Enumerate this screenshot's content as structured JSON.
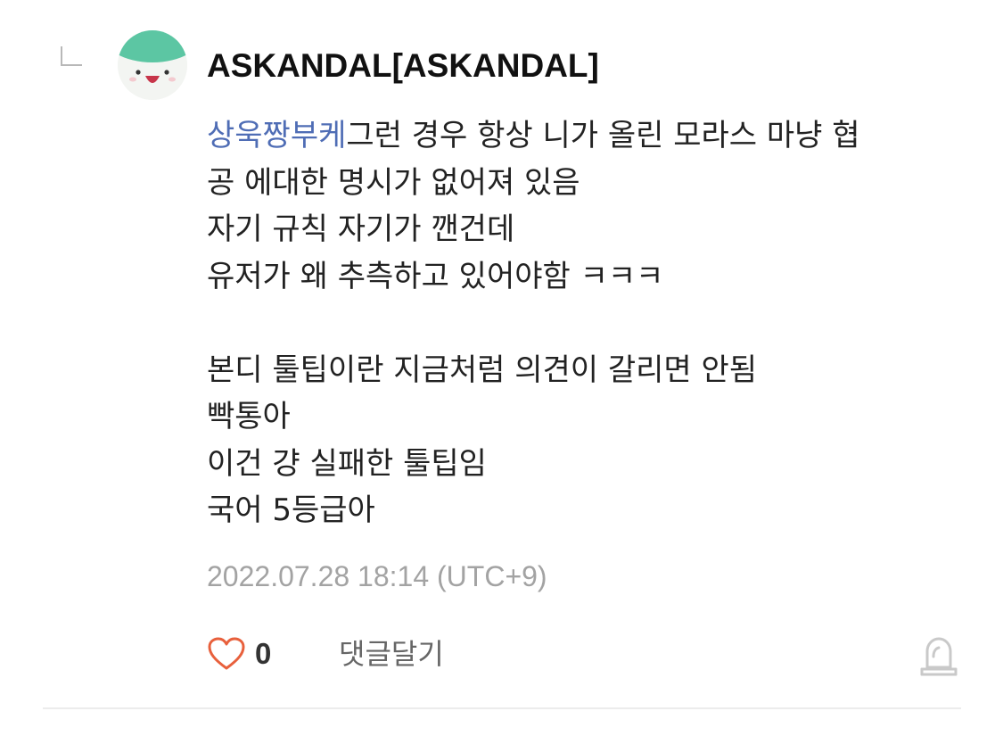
{
  "comment": {
    "author": "ASKANDAL[ASKANDAL]",
    "mention": "상욱짱부케",
    "lines": [
      "그런 경우 항상 니가 올린 모라스 마냥 협",
      "공 에대한 명시가 없어져 있음",
      "자기 규칙 자기가 깬건데",
      "유저가 왜 추측하고 있어야함 ㅋㅋㅋ",
      "",
      "본디 툴팁이란 지금처럼 의견이 갈리면 안됨",
      "빡통아",
      "이건 걍 실패한 툴팁임",
      "국어 5등급아"
    ],
    "timestamp": "2022.07.28 18:14 (UTC+9)",
    "like_count": "0",
    "reply_label": "댓글달기"
  },
  "icons": {
    "reply_marker": "reply-indent-icon",
    "avatar": "avatar-character-icon",
    "like": "heart-outline-icon",
    "report": "siren-icon"
  },
  "colors": {
    "mention": "#4f6db5",
    "timestamp": "#a3a3a3",
    "heart": "#e8603c",
    "avatar_top": "#5cc6a3",
    "divider": "#ececec"
  }
}
